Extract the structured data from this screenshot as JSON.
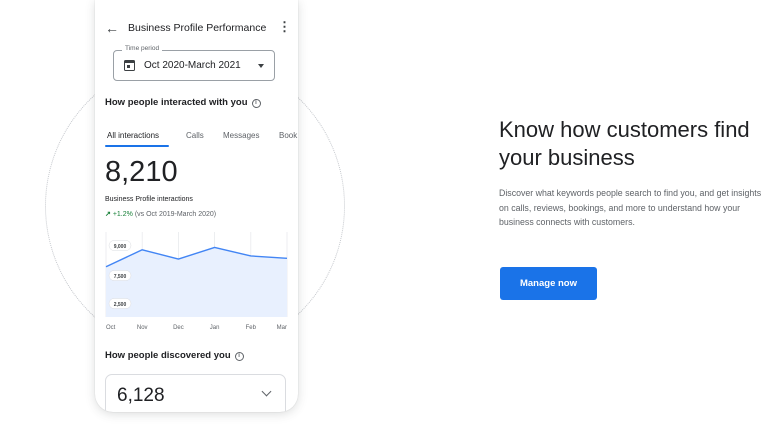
{
  "app_bar": {
    "back_glyph": "←",
    "title": "Business Profile Performance",
    "menu_glyph": "⋮"
  },
  "time_period": {
    "label": "Time period",
    "value": "Oct 2020-March 2021"
  },
  "interactions": {
    "heading": "How people interacted with you",
    "info_glyph": "i",
    "tabs": [
      {
        "label": "All interactions",
        "active": true
      },
      {
        "label": "Calls",
        "active": false
      },
      {
        "label": "Messages",
        "active": false
      },
      {
        "label": "Book",
        "active": false
      }
    ],
    "total": "8,210",
    "metric_label": "Business Profile interactions",
    "trend": {
      "arrow": "↗",
      "change": "+1.2%",
      "comparison": "(vs Oct 2019-March 2020)"
    }
  },
  "chart_data": {
    "type": "area",
    "x": [
      "Oct",
      "Nov",
      "Dec",
      "Jan",
      "Feb",
      "Mar"
    ],
    "series": [
      {
        "values": [
          6500,
          8700,
          7500,
          9000,
          7900,
          7600
        ]
      }
    ],
    "y_ticks": [
      "9,000",
      "7,500",
      "2,500"
    ],
    "ylim": [
      0,
      11000
    ],
    "grid": "vertical",
    "line_color": "#4285f4",
    "fill_color": "#e8f0fe"
  },
  "discovered": {
    "heading": "How people discovered you",
    "info_glyph": "i",
    "total": "6,128"
  },
  "promo": {
    "headline": "Know how customers find your business",
    "description": "Discover what keywords people search to find you, and get insights on calls, reviews, bookings, and more to understand how your business connects with customers.",
    "cta_label": "Manage now"
  },
  "colors": {
    "accent": "#1a73e8",
    "positive": "#188038"
  }
}
